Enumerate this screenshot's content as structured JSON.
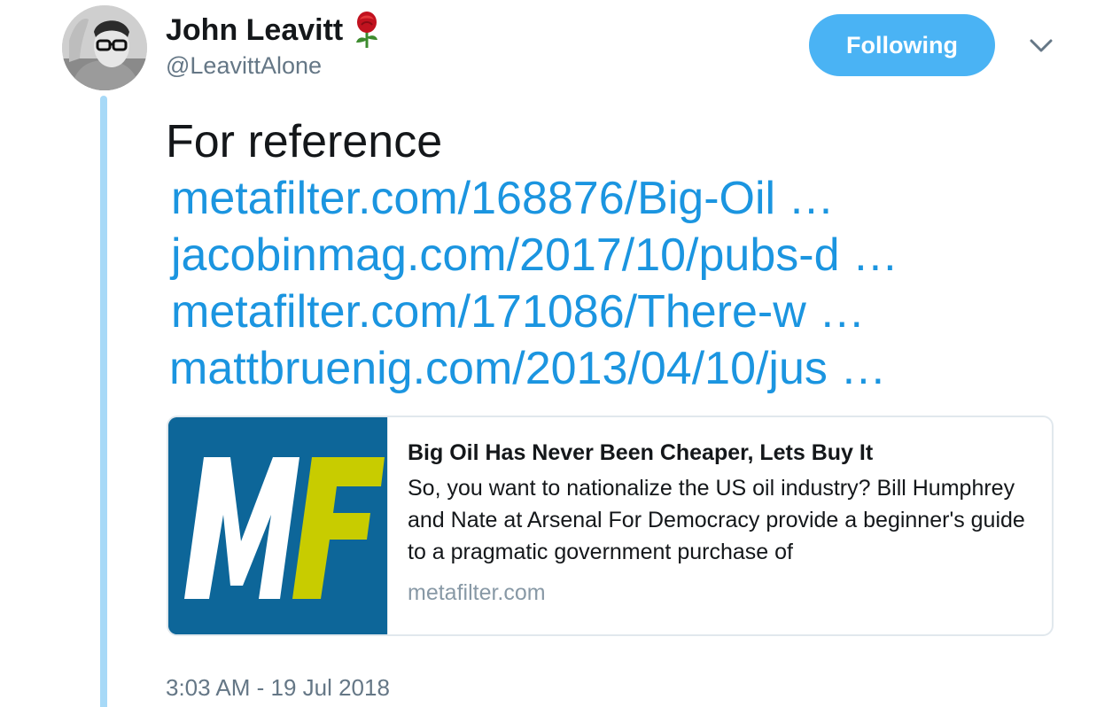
{
  "author": {
    "display_name": "John Leavitt",
    "handle": "@LeavittAlone",
    "name_emoji_icon": "rose-icon"
  },
  "header": {
    "follow_label": "Following",
    "menu_icon": "chevron-down-icon"
  },
  "tweet": {
    "text": "For reference",
    "links": [
      "metafilter.com/168876/Big-Oil  …",
      "jacobinmag.com/2017/10/pubs-d  …",
      "metafilter.com/171086/There-w   …",
      "mattbruenig.com/2013/04/10/jus …"
    ],
    "timestamp": "3:03 AM - 19 Jul 2018"
  },
  "card": {
    "thumb_letters": "MF",
    "title": "Big Oil Has Never Been Cheaper, Lets Buy It",
    "description": "So, you want to nationalize the US oil industry? Bill Humphrey and Nate at Arsenal For Democracy provide a beginner's guide to a pragmatic government purchase of",
    "domain": "metafilter.com"
  },
  "colors": {
    "link": "#1b95e0",
    "follow_bg": "#4ab3f4",
    "thread_line": "#a7d9f7",
    "thumb_bg": "#0d6699",
    "thumb_accent": "#c8cc00",
    "muted": "#657786"
  }
}
